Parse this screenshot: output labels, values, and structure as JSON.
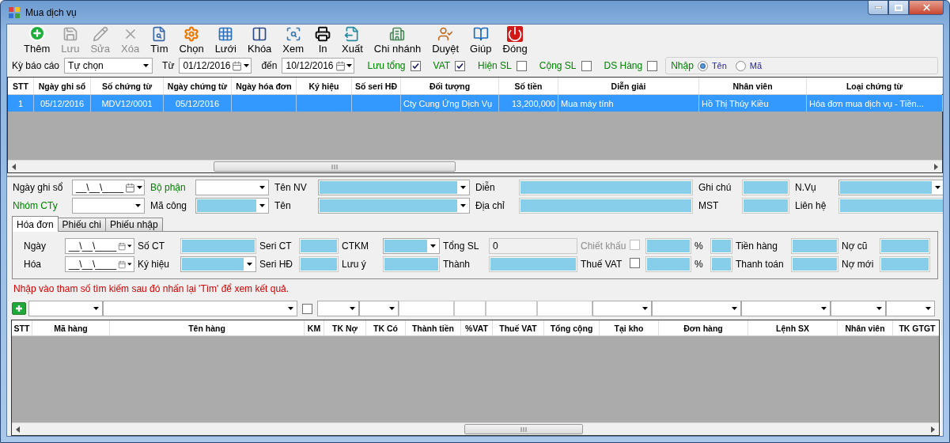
{
  "window": {
    "title": "Mua dịch vụ"
  },
  "toolbar": [
    {
      "label": "Thêm",
      "disabled": false
    },
    {
      "label": "Lưu",
      "disabled": true
    },
    {
      "label": "Sửa",
      "disabled": true
    },
    {
      "label": "Xóa",
      "disabled": true
    },
    {
      "label": "Tìm",
      "disabled": false
    },
    {
      "label": "Chọn",
      "disabled": false
    },
    {
      "label": "Lưới",
      "disabled": false
    },
    {
      "label": "Khóa",
      "disabled": false
    },
    {
      "label": "Xem",
      "disabled": false
    },
    {
      "label": "In",
      "disabled": false
    },
    {
      "label": "Xuất",
      "disabled": false
    },
    {
      "label": "Chi nhánh",
      "disabled": false
    },
    {
      "label": "Duyệt",
      "disabled": false
    },
    {
      "label": "Giúp",
      "disabled": false
    },
    {
      "label": "Đóng",
      "disabled": false
    }
  ],
  "filters": {
    "period": {
      "label": "Kỳ báo cáo",
      "value": "Tự chọn"
    },
    "from": {
      "label": "Từ",
      "value": "01/12/2016"
    },
    "to": {
      "label": "đến",
      "value": "10/12/2016"
    },
    "checks": [
      {
        "label": "Lưu tổng",
        "checked": true
      },
      {
        "label": "VAT",
        "checked": true
      },
      {
        "label": "Hiện SL",
        "checked": false
      },
      {
        "label": "Cộng SL",
        "checked": false
      },
      {
        "label": "DS Hàng",
        "checked": false
      }
    ],
    "input_mode": {
      "label": "Nhập",
      "options": [
        {
          "label": "Tên",
          "selected": true
        },
        {
          "label": "Mã",
          "selected": false
        }
      ]
    }
  },
  "voucher_grid": {
    "columns": [
      "STT",
      "Ngày ghi sổ",
      "Số chứng từ",
      "Ngày chứng từ",
      "Ngày hóa đơn",
      "Ký hiệu",
      "Số seri HĐ",
      "Đối tượng",
      "Số tiền",
      "Diễn giải",
      "Nhân viên",
      "Loại chứng từ"
    ],
    "rows": [
      {
        "selected": true,
        "cells": [
          "1",
          "05/12/2016",
          "MDV12/0001",
          "05/12/2016",
          "",
          "",
          "",
          "Cty Cung Ứng Dịch Vụ",
          "13,200,000",
          "Mua máy tính",
          "Hồ Thị Thúy Kiều",
          "Hóa đơn mua dịch vụ - Tiền..."
        ]
      }
    ]
  },
  "form": {
    "rows": [
      [
        {
          "kind": "label",
          "text": "Ngày ghi sổ",
          "color": "#000000"
        },
        {
          "kind": "date",
          "value": "__\\__\\____"
        },
        {
          "kind": "label",
          "text": "Bộ phận",
          "color": "#008000"
        },
        {
          "kind": "combo",
          "highlighted": false
        },
        {
          "kind": "label",
          "text": "Tên NV",
          "color": "#000000"
        },
        {
          "kind": "combo",
          "highlighted": true
        },
        {
          "kind": "label",
          "text": "Diễn",
          "color": "#000000"
        },
        {
          "kind": "text",
          "highlighted": true
        },
        {
          "kind": "label",
          "text": "Ghi chú",
          "color": "#000000"
        },
        {
          "kind": "text",
          "highlighted": true
        },
        {
          "kind": "label",
          "text": "N.Vụ",
          "color": "#000000"
        },
        {
          "kind": "combo",
          "highlighted": true
        }
      ],
      [
        {
          "kind": "label",
          "text": "Nhóm CTy",
          "color": "#008000"
        },
        {
          "kind": "combo",
          "highlighted": false
        },
        {
          "kind": "label",
          "text": "Mã công",
          "color": "#000000"
        },
        {
          "kind": "combo",
          "highlighted": true
        },
        {
          "kind": "label",
          "text": "Tên",
          "color": "#000000"
        },
        {
          "kind": "combo",
          "highlighted": true
        },
        {
          "kind": "label",
          "text": "Địa chỉ",
          "color": "#000000"
        },
        {
          "kind": "text",
          "highlighted": true
        },
        {
          "kind": "label",
          "text": "MST",
          "color": "#000000"
        },
        {
          "kind": "text",
          "highlighted": true
        },
        {
          "kind": "label",
          "text": "Liên hệ",
          "color": "#000000"
        },
        {
          "kind": "text",
          "highlighted": true
        }
      ]
    ]
  },
  "tabs": [
    {
      "label": "Hóa đơn",
      "selected": true
    },
    {
      "label": "Phiếu chi",
      "selected": false
    },
    {
      "label": "Phiếu nhập",
      "selected": false
    }
  ],
  "invoice_panel": {
    "rows": [
      [
        {
          "kind": "label",
          "text": "Ngày"
        },
        {
          "kind": "date",
          "value": "__\\__\\____"
        },
        {
          "kind": "label",
          "text": "Số CT"
        },
        {
          "kind": "text",
          "highlighted": true
        },
        {
          "kind": "label",
          "text": "Seri CT"
        },
        {
          "kind": "text",
          "highlighted": true
        },
        {
          "kind": "label",
          "text": "CTKM"
        },
        {
          "kind": "combo",
          "highlighted": true
        },
        {
          "kind": "label",
          "text": "Tổng SL"
        },
        {
          "kind": "text",
          "value": "0",
          "highlighted": false,
          "readonly": true
        },
        {
          "kind": "label",
          "text": "Chiết khấu",
          "disabled": true
        },
        {
          "kind": "check",
          "checked": false,
          "disabled": true
        },
        {
          "kind": "text",
          "highlighted": true
        },
        {
          "kind": "label",
          "text": "%"
        },
        {
          "kind": "text",
          "highlighted": true
        },
        {
          "kind": "label",
          "text": "Tiền hàng"
        },
        {
          "kind": "text",
          "highlighted": true
        },
        {
          "kind": "label",
          "text": "Nợ cũ"
        },
        {
          "kind": "text",
          "highlighted": true
        }
      ],
      [
        {
          "kind": "label",
          "text": "Hóa"
        },
        {
          "kind": "date",
          "value": "__\\__\\____"
        },
        {
          "kind": "label",
          "text": "Ký hiệu"
        },
        {
          "kind": "combo",
          "highlighted": true
        },
        {
          "kind": "label",
          "text": "Seri HĐ"
        },
        {
          "kind": "text",
          "highlighted": true
        },
        {
          "kind": "label",
          "text": "Lưu ý"
        },
        {
          "kind": "text",
          "highlighted": true
        },
        {
          "kind": "label",
          "text": "Thành"
        },
        {
          "kind": "text",
          "highlighted": true
        },
        {
          "kind": "label",
          "text": "Thuế VAT"
        },
        {
          "kind": "check",
          "checked": false,
          "disabled": false
        },
        {
          "kind": "text",
          "highlighted": true
        },
        {
          "kind": "label",
          "text": "%"
        },
        {
          "kind": "text",
          "highlighted": true
        },
        {
          "kind": "label",
          "text": "Thanh toán"
        },
        {
          "kind": "text",
          "highlighted": true
        },
        {
          "kind": "label",
          "text": "Nợ mới"
        },
        {
          "kind": "text",
          "highlighted": true
        }
      ]
    ]
  },
  "hint": "Nhập vào tham số tìm kiếm sau đó nhấn lại 'Tìm' để xem kết quả.",
  "detail_grid": {
    "columns": [
      {
        "label": "STT"
      },
      {
        "label": "Mã hàng",
        "filter": {
          "kind": "combo"
        }
      },
      {
        "label": "Tên hàng",
        "filter": {
          "kind": "combo"
        }
      },
      {
        "label": "KM",
        "filter": {
          "kind": "check",
          "checked": false
        }
      },
      {
        "label": "TK Nợ",
        "filter": {
          "kind": "combo"
        }
      },
      {
        "label": "TK Có",
        "filter": {
          "kind": "combo"
        }
      },
      {
        "label": "Thành tiền",
        "filter": {
          "kind": "text"
        }
      },
      {
        "label": "%VAT",
        "filter": {
          "kind": "text"
        }
      },
      {
        "label": "Thuế VAT",
        "filter": {
          "kind": "text"
        }
      },
      {
        "label": "Tổng cộng",
        "filter": {
          "kind": "text"
        }
      },
      {
        "label": "Tại kho",
        "filter": {
          "kind": "combo"
        }
      },
      {
        "label": "Đơn hàng",
        "filter": {
          "kind": "combo"
        }
      },
      {
        "label": "Lệnh SX",
        "filter": {
          "kind": "combo"
        }
      },
      {
        "label": "Nhân viên",
        "filter": {
          "kind": "combo"
        }
      },
      {
        "label": "TK GTGT",
        "filter": {
          "kind": "combo"
        }
      }
    ]
  }
}
